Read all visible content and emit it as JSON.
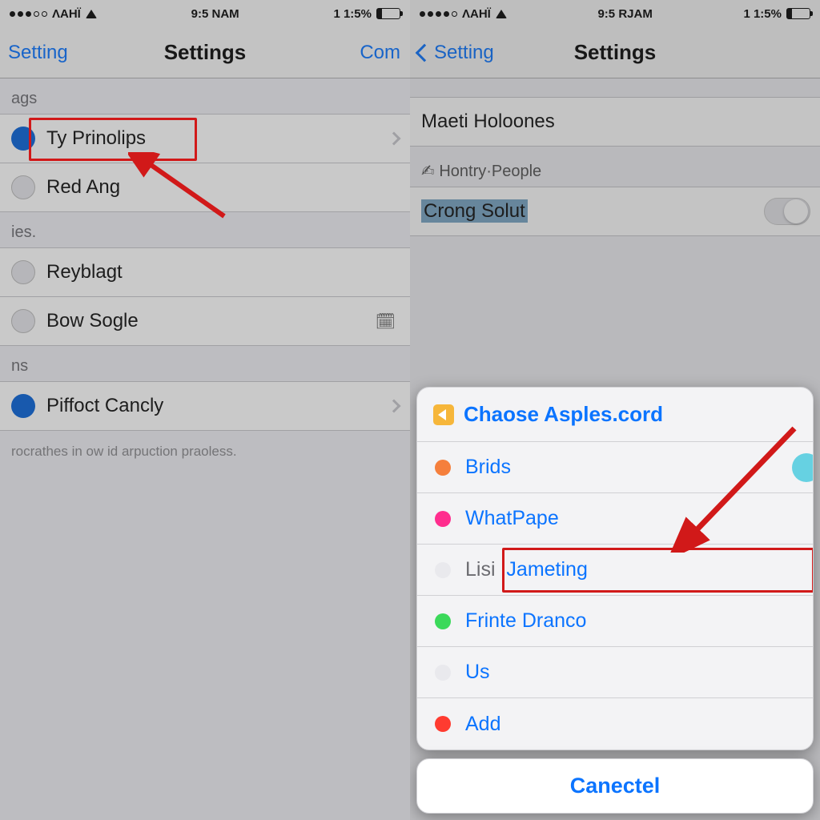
{
  "left": {
    "status": {
      "carrier": "ΛΑΗΪ",
      "time": "9:5 NAM",
      "battery": "1 1:5%"
    },
    "nav": {
      "back": "Setting",
      "title": "Settings",
      "right": "Com"
    },
    "section1": {
      "header": "ags",
      "item1": "Ty Prinolips",
      "item2": "Red Ang"
    },
    "section2": {
      "header": "ies.",
      "item1": "Reyblagt",
      "item2": "Bow Sogle"
    },
    "section3": {
      "header": "ns",
      "item1": "Piffoct Cancly"
    },
    "footnote": "rocrathes in ow id arpuction praoless."
  },
  "right": {
    "status": {
      "carrier": "ΛΑΗΪ",
      "time": "9:5 RJAM",
      "battery": "1 1:5%"
    },
    "nav": {
      "back": "Setting",
      "title": "Settings"
    },
    "rows": {
      "item1": "Maeti Holoones",
      "sub": "Hontry·People",
      "item2": "Crong Solut"
    },
    "sheet": {
      "title": "Chaose Asples.cord",
      "options": [
        "Brids",
        "WhatPape",
        "Lisi Jameting",
        "Frinte Dranco",
        "Us",
        "Add"
      ],
      "split_prefix": "Lisi",
      "split_rest": "Jameting",
      "cancel": "Canectel"
    }
  }
}
